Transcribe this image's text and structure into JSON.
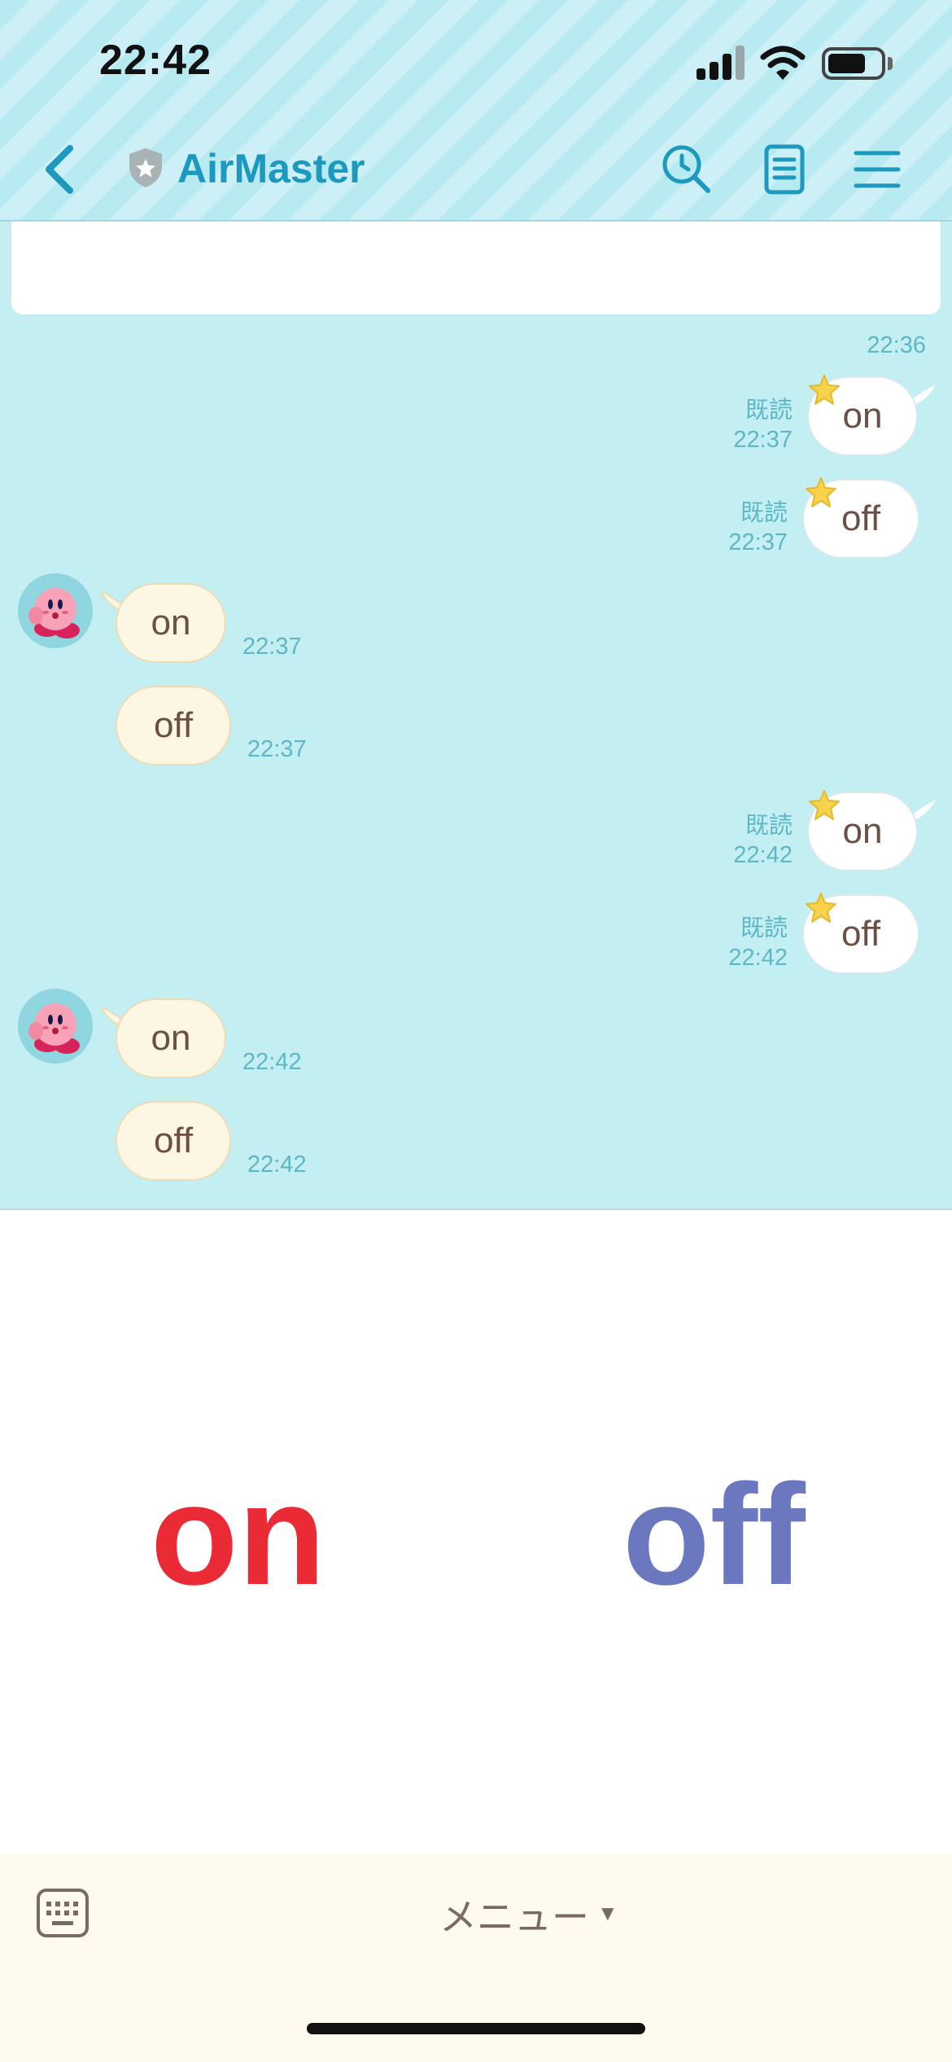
{
  "status_bar": {
    "time": "22:42",
    "battery_level": 0.72,
    "signal_bars": 3,
    "signal_bars_total": 4
  },
  "nav": {
    "title": "AirMaster",
    "back_icon": "chevron-left-icon",
    "shield_icon": "shield-star-icon",
    "search_icon": "search-clock-icon",
    "notes_icon": "notes-icon",
    "menu_icon": "hamburger-icon"
  },
  "chat": {
    "first_timestamp": "22:36",
    "read_label": "既読",
    "messages": [
      {
        "direction": "out",
        "text": "on",
        "time": "22:37",
        "read": true
      },
      {
        "direction": "out",
        "text": "off",
        "time": "22:37",
        "read": true
      },
      {
        "direction": "in",
        "text": "on",
        "time": "22:37",
        "avatar": true
      },
      {
        "direction": "in",
        "text": "off",
        "time": "22:37"
      },
      {
        "direction": "out",
        "text": "on",
        "time": "22:42",
        "read": true
      },
      {
        "direction": "out",
        "text": "off",
        "time": "22:42",
        "read": true
      },
      {
        "direction": "in",
        "text": "on",
        "time": "22:42",
        "avatar": true
      },
      {
        "direction": "in",
        "text": "off",
        "time": "22:42"
      }
    ]
  },
  "rich_menu": {
    "on_label": "on",
    "on_color": "#ea2b36",
    "off_label": "off",
    "off_color": "#6b78c0"
  },
  "bottom_bar": {
    "keyboard_icon": "keyboard-icon",
    "menu_label": "メニュー",
    "caret": "▼"
  }
}
